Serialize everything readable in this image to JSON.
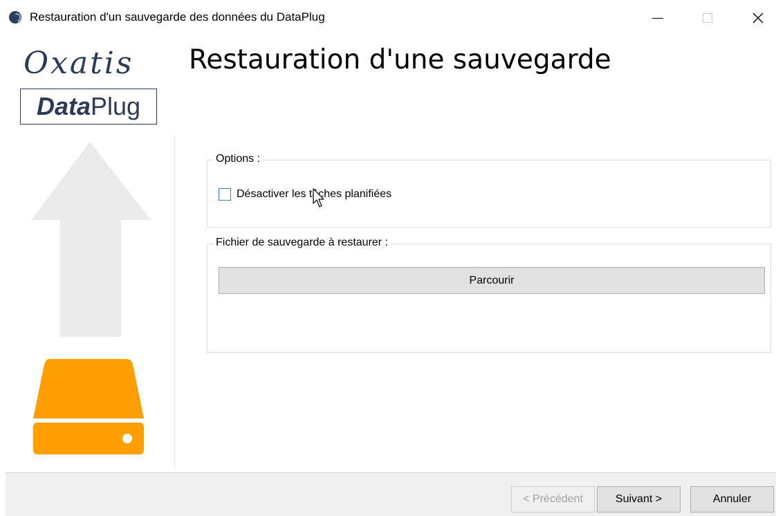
{
  "window": {
    "title": "Restauration d'un sauvegarde des données du DataPlug",
    "controls": [
      "minimize-icon",
      "maximize-icon",
      "close-icon"
    ]
  },
  "branding": {
    "logo_text": "Oxatis",
    "product_bold": "Data",
    "product_regular": "Plug",
    "arrow_icon": "up-arrow-icon",
    "drive_icon": "hard-drive-icon",
    "colors": {
      "navy": "#2a3b57",
      "arrow": "#ebebeb",
      "drive": "#ff9e00"
    }
  },
  "main": {
    "page_title": "Restauration d'une sauvegarde",
    "options": {
      "legend": "Options :",
      "checkbox_label": "Désactiver les tâches planifiées",
      "checked": false
    },
    "file": {
      "legend": "Fichier de sauvegarde à restaurer :",
      "browse_label": "Parcourir"
    }
  },
  "footer": {
    "prev_label": "< Précédent",
    "prev_enabled": false,
    "next_label": "Suivant >",
    "cancel_label": "Annuler"
  }
}
